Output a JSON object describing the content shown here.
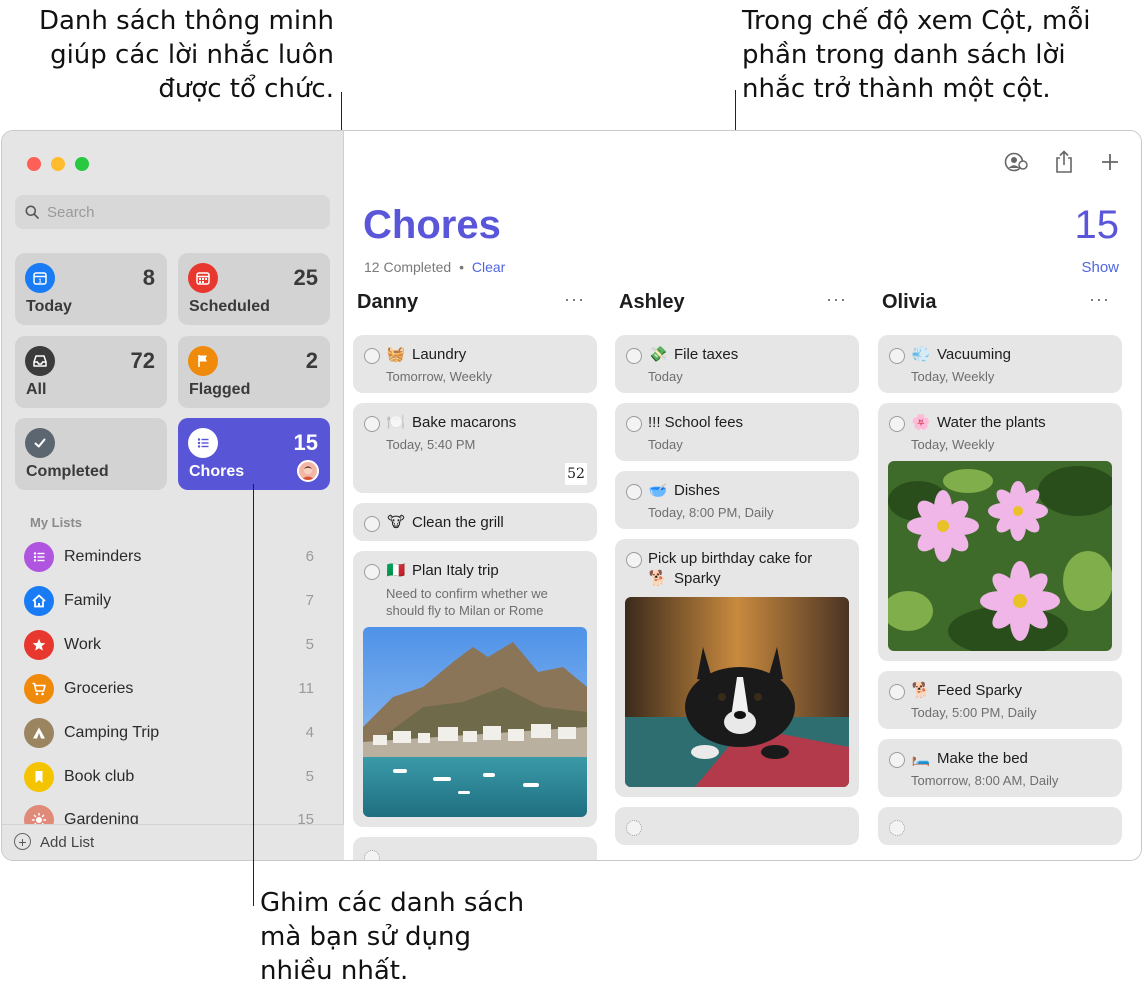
{
  "callouts": {
    "left": [
      "Danh sách thông minh",
      "giúp các lời nhắc luôn",
      "được tổ chức."
    ],
    "right": [
      "Trong chế độ xem Cột, mỗi",
      "phần trong danh sách lời",
      "nhắc trở thành một cột."
    ],
    "bottom": [
      "Ghim các danh sách",
      "mà bạn sử dụng",
      "nhiều nhất."
    ]
  },
  "sidebar": {
    "search_placeholder": "Search",
    "smart_lists": [
      {
        "label": "Today",
        "count": "8",
        "icon": "calendar-icon",
        "color": "#1a7cf5"
      },
      {
        "label": "Scheduled",
        "count": "25",
        "icon": "calendar-grid-icon",
        "color": "#e8372f"
      },
      {
        "label": "All",
        "count": "72",
        "icon": "tray-icon",
        "color": "#3b3b3b"
      },
      {
        "label": "Flagged",
        "count": "2",
        "icon": "flag-icon",
        "color": "#f08a0a"
      },
      {
        "label": "Completed",
        "count": "",
        "icon": "checkmark-icon",
        "color": "#5b6670"
      },
      {
        "label": "Chores",
        "count": "15",
        "icon": "list-icon",
        "color": "#5856d6"
      }
    ],
    "my_lists_title": "My Lists",
    "lists": [
      {
        "name": "Reminders",
        "count": "6",
        "icon": "list-icon",
        "color": "#b055e0"
      },
      {
        "name": "Family",
        "count": "7",
        "icon": "house-icon",
        "color": "#1a7cf5"
      },
      {
        "name": "Work",
        "count": "5",
        "icon": "star-icon",
        "color": "#e8372f"
      },
      {
        "name": "Groceries",
        "count": "11",
        "icon": "cart-icon",
        "color": "#f08a0a"
      },
      {
        "name": "Camping Trip",
        "count": "4",
        "icon": "tent-icon",
        "color": "#9a8560"
      },
      {
        "name": "Book club",
        "count": "5",
        "icon": "bookmark-icon",
        "color": "#f5c400"
      },
      {
        "name": "Gardening",
        "count": "15",
        "icon": "sun-icon",
        "color": "#e08a7a"
      }
    ],
    "add_list": "Add List"
  },
  "main": {
    "title": "Chores",
    "count": "15",
    "completed_text": "12 Completed",
    "separator": "•",
    "clear_label": "Clear",
    "show_label": "Show",
    "columns": [
      {
        "name": "Danny",
        "more": "···",
        "cards": [
          {
            "emoji": "🧺",
            "title": "Laundry",
            "sub": "Tomorrow, Weekly"
          },
          {
            "emoji": "🍽️",
            "title": "Bake macarons",
            "sub": "Today, 5:40 PM",
            "badge": "52"
          },
          {
            "emoji": "🐮",
            "title": "Clean the grill"
          },
          {
            "emoji": "🇮🇹",
            "title": "Plan Italy trip",
            "note": "Need to confirm whether we should fly to Milan or Rome"
          }
        ]
      },
      {
        "name": "Ashley",
        "more": "···",
        "cards": [
          {
            "emoji": "💸",
            "title": "File taxes",
            "sub": "Today"
          },
          {
            "emoji": "",
            "title": "!!! School fees",
            "sub": "Today"
          },
          {
            "emoji": "🥣",
            "title": "Dishes",
            "sub": "Today, 8:00 PM, Daily"
          },
          {
            "emoji": "🐕",
            "title": "Pick up birthday cake for",
            "title_line2": "Sparky"
          }
        ]
      },
      {
        "name": "Olivia",
        "more": "···",
        "cards": [
          {
            "emoji": "💨",
            "title": "Vacuuming",
            "sub": "Today, Weekly"
          },
          {
            "emoji": "🌸",
            "title": "Water the plants",
            "sub": "Today, Weekly"
          },
          {
            "emoji": "🐕",
            "title": "Feed Sparky",
            "sub": "Today, 5:00 PM, Daily"
          },
          {
            "emoji": "🛏️",
            "title": "Make the bed",
            "sub": "Tomorrow, 8:00 AM, Daily"
          }
        ]
      }
    ]
  }
}
